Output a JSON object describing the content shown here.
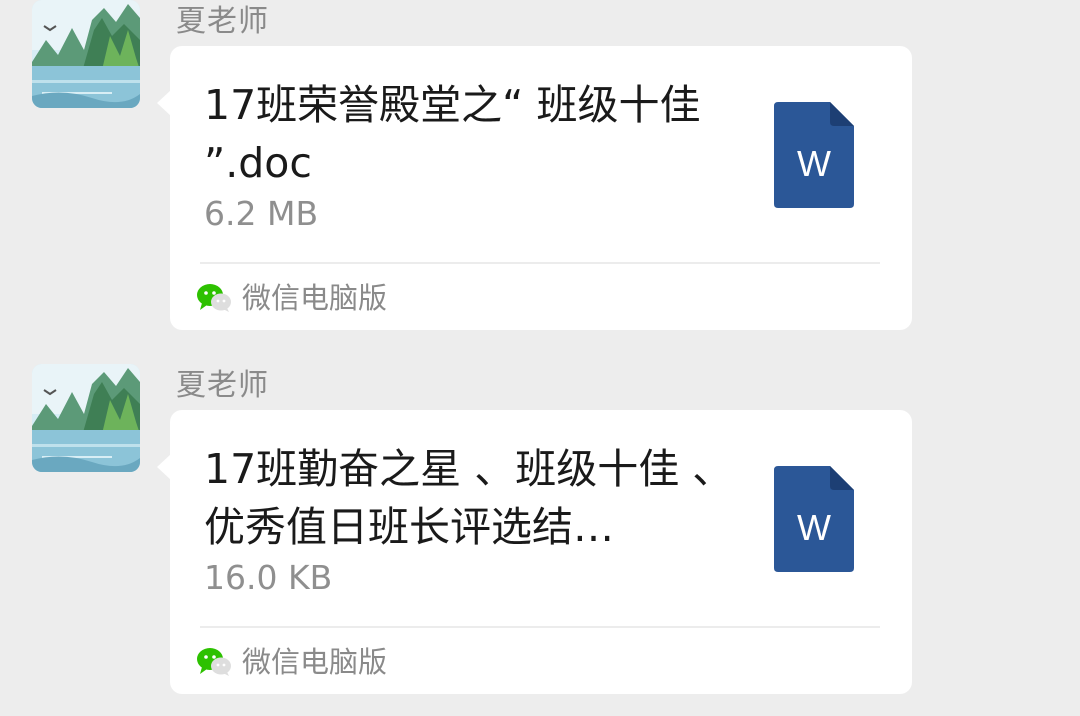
{
  "messages": [
    {
      "sender": "夏老师",
      "file_name": "17班荣誉殿堂之“ 班级十佳 ”.doc",
      "file_size": "6.2 MB",
      "file_type_icon": "word-doc-icon",
      "file_icon_letter": "W",
      "source": "微信电脑版"
    },
    {
      "sender": "夏老师",
      "file_name": "17班勤奋之星 、班级十佳 、优秀值日班长评选结…",
      "file_size": "16.0 KB",
      "file_type_icon": "word-doc-icon",
      "file_icon_letter": "W",
      "source": "微信电脑版"
    }
  ],
  "colors": {
    "background": "#ededed",
    "bubble": "#ffffff",
    "word_blue": "#2b5797",
    "wechat_green": "#2dc100"
  }
}
